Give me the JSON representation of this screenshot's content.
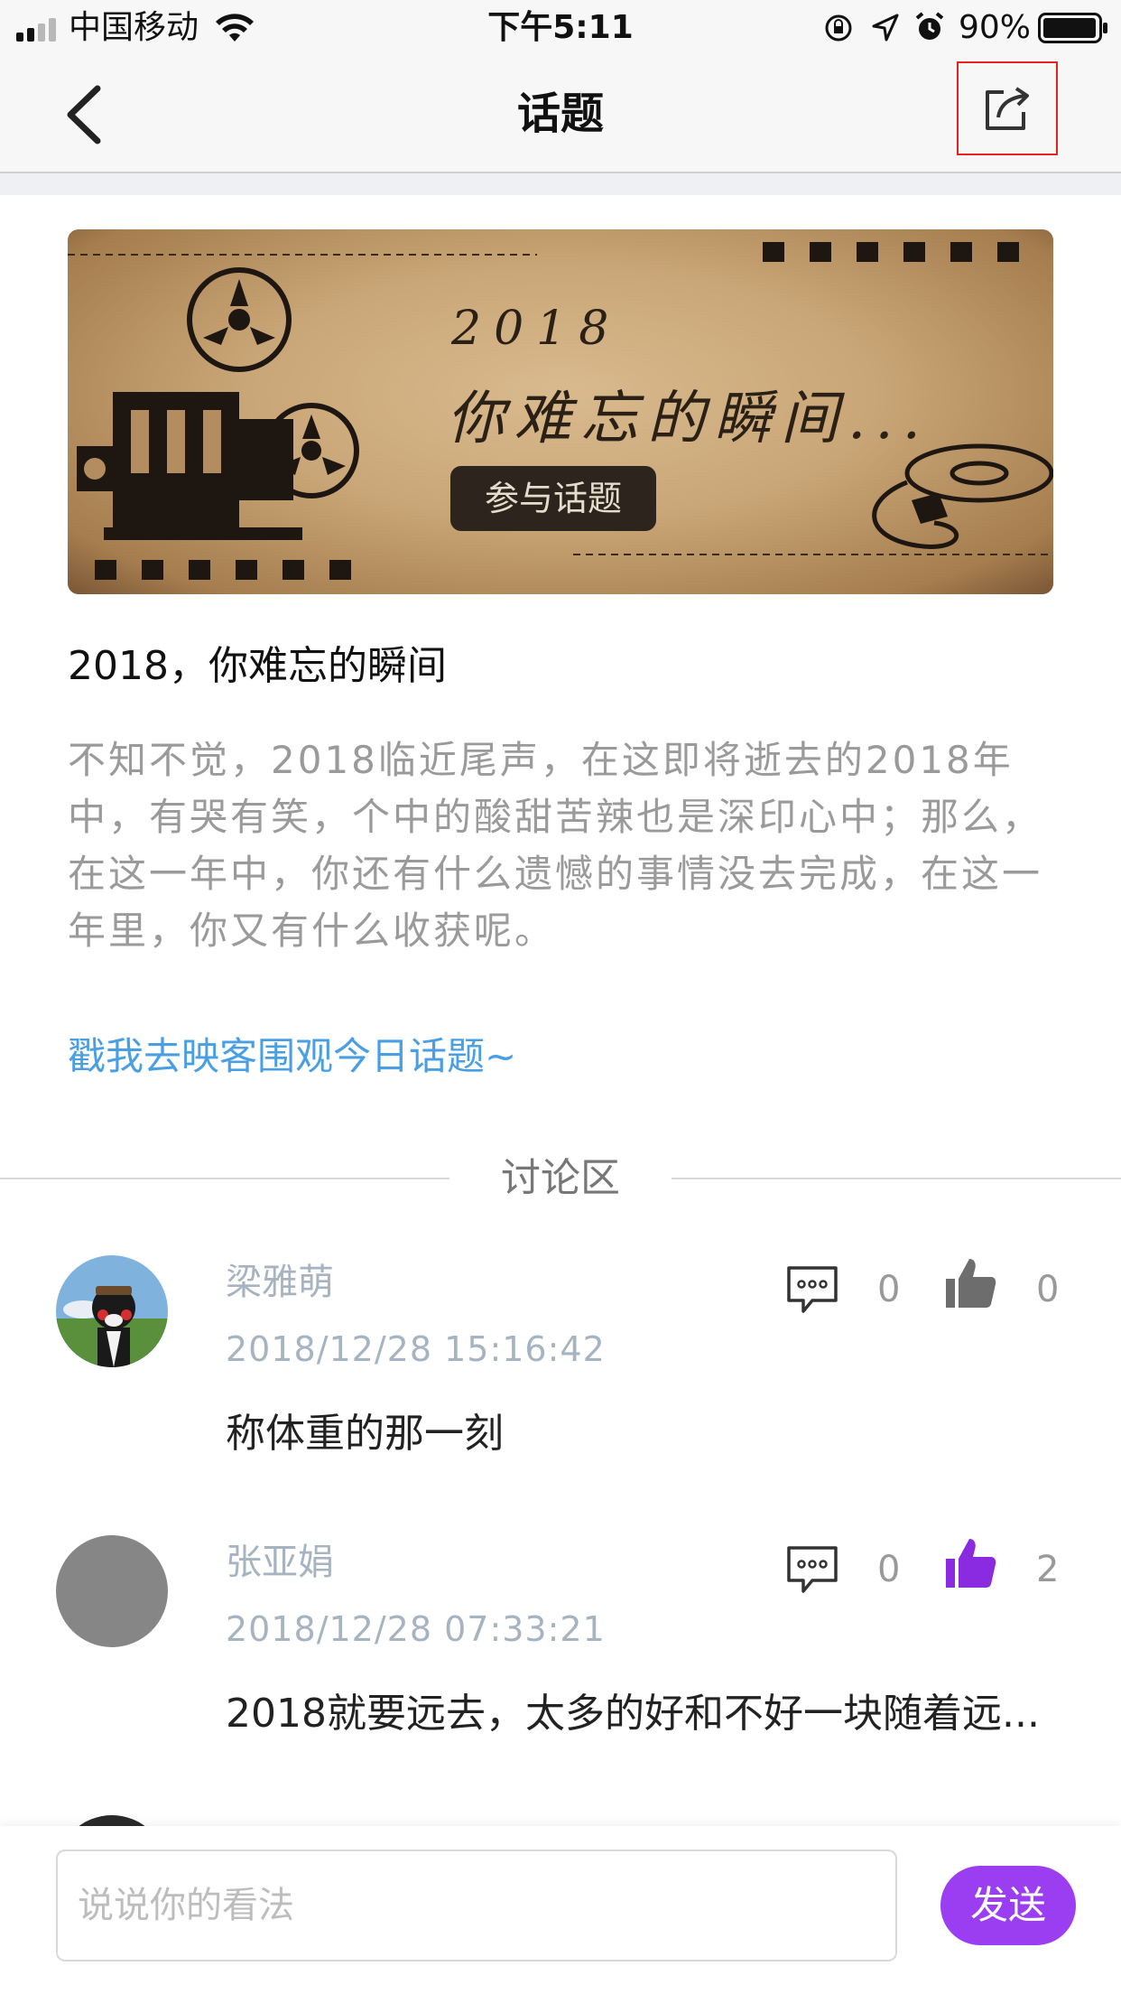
{
  "status_bar": {
    "carrier": "中国移动",
    "time": "下午5:11",
    "battery": "90%"
  },
  "nav": {
    "title": "话题",
    "back_icon": "chevron-left-icon",
    "share_icon": "share-icon"
  },
  "banner": {
    "year": "2018",
    "headline": "你难忘的瞬间...",
    "button_label": "参与话题"
  },
  "topic": {
    "title": "2018，你难忘的瞬间",
    "description": "不知不觉，2018临近尾声，在这即将逝去的2018年中，有哭有笑，个中的酸甜苦辣也是深印心中；那么，在这一年中，你还有什么遗憾的事情没去完成，在这一年里，你又有什么收获呢。",
    "link": "戳我去映客围观今日话题~"
  },
  "discussion": {
    "label": "讨论区",
    "comments": [
      {
        "name": "梁雅萌",
        "time": "2018/12/28  15:16:42",
        "text": "称体重的那一刻",
        "reply_count": "0",
        "like_count": "0",
        "liked": false
      },
      {
        "name": "张亚娟",
        "time": "2018/12/28  07:33:21",
        "text": "2018就要远去，太多的好和不好一块随着远...",
        "reply_count": "0",
        "like_count": "2",
        "liked": true
      }
    ]
  },
  "composer": {
    "placeholder": "说说你的看法",
    "send_label": "发送"
  },
  "colors": {
    "accent": "#9b3df0",
    "link": "#4a9fe3",
    "meta_text": "#a6b3c0",
    "highlight_border": "#e8231f"
  }
}
